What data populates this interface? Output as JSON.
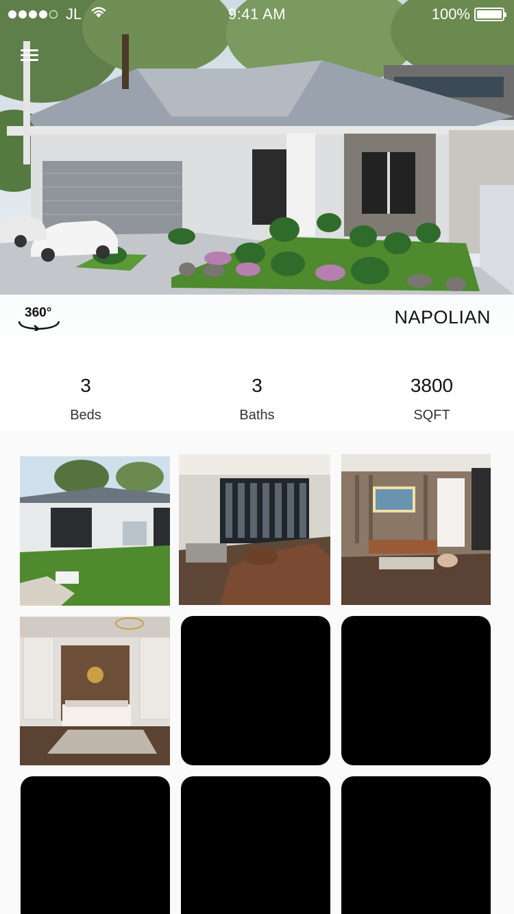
{
  "status_bar": {
    "carrier": "JL",
    "time": "9:41 AM",
    "battery": "100%"
  },
  "hero": {
    "title": "NAPOLIAN",
    "view360_label": "360°"
  },
  "stats": [
    {
      "value": "3",
      "label": "Beds"
    },
    {
      "value": "3",
      "label": "Baths"
    },
    {
      "value": "3800",
      "label": "SQFT"
    }
  ],
  "gallery": {
    "tiles": [
      {
        "kind": "image",
        "subject": "exterior-patio"
      },
      {
        "kind": "image",
        "subject": "living-room-windows"
      },
      {
        "kind": "image",
        "subject": "living-room-painting"
      },
      {
        "kind": "image",
        "subject": "bedroom"
      },
      {
        "kind": "placeholder"
      },
      {
        "kind": "placeholder"
      },
      {
        "kind": "placeholder"
      },
      {
        "kind": "placeholder"
      },
      {
        "kind": "placeholder"
      }
    ]
  },
  "icons": [
    "menu-icon",
    "wifi-icon",
    "battery-icon",
    "rotate-360-icon"
  ],
  "colors": {
    "accent_text": "#111111",
    "placeholder": "#000000",
    "sky": "#dfe8ee",
    "lawn": "#4f8a2e"
  }
}
